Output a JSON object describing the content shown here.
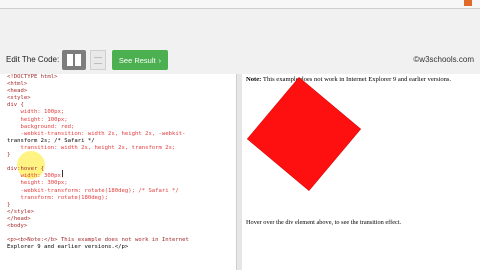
{
  "toolbar": {
    "edit_label": "Edit The Code:",
    "see_result_label": "See Result",
    "see_result_arrow": "›",
    "brand": "©w3schools.com"
  },
  "code_lines": [
    "<!DOCTYPE html>",
    "<html>",
    "<head>",
    "<style>",
    "div {",
    "    width: 100px;",
    "    height: 100px;",
    "    background: red;",
    "    -webkit-transition: width 2s, height 2s, -webkit-",
    "transform 2s; /* Safari */",
    "    transition: width 2s, height 2s, transform 2s;",
    "}",
    "",
    "div:hover {",
    "    width: 300px;",
    "    height: 300px;",
    "    -webkit-transform: rotate(180deg); /* Safari */",
    "    transform: rotate(180deg);",
    "}",
    "</style>",
    "</head>",
    "<body>",
    "",
    "<p><b>Note:</b> This example does not work in Internet",
    "Explorer 9 and earlier versions.</p>"
  ],
  "result": {
    "note_bold": "Note:",
    "note_text": " This example does not work in Internet Explorer 9 and earlier versions.",
    "hover_text": "Hover over the div element above, to see the transition effect.",
    "box_color": "#ff1010"
  },
  "colors": {
    "see_result_bg": "#4caf50",
    "code_tag": "#a52a2a",
    "code_prop": "#e23b3b"
  }
}
